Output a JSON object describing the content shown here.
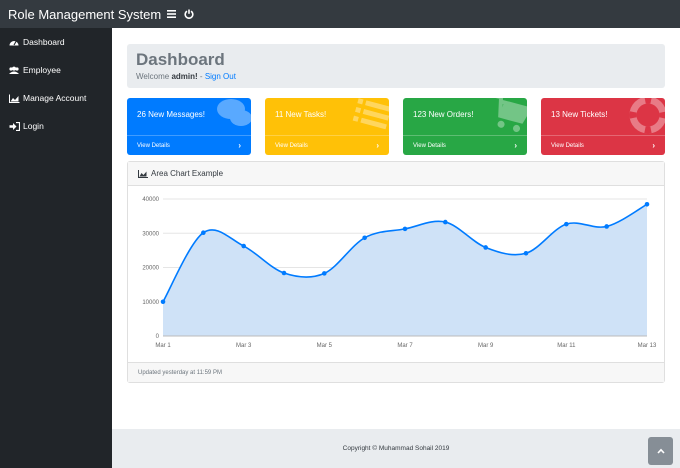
{
  "navbar": {
    "brand": "Role Management System",
    "toggle_icon": "bars-icon",
    "power_icon": "power-icon"
  },
  "sidebar": {
    "items": [
      {
        "label": "Dashboard",
        "icon": "tachometer-icon"
      },
      {
        "label": "Employee",
        "icon": "users-icon"
      },
      {
        "label": "Manage Account",
        "icon": "chart-area-icon"
      },
      {
        "label": "Login",
        "icon": "sign-in-icon"
      }
    ]
  },
  "jumbotron": {
    "title": "Dashboard",
    "welcome_prefix": "Welcome",
    "username": "admin!",
    "separator": "-",
    "signout": "Sign Out"
  },
  "cards": [
    {
      "title": "26 New Messages!",
      "footer": "View Details",
      "color": "#007bff",
      "icon": "comments-icon"
    },
    {
      "title": "11 New Tasks!",
      "footer": "View Details",
      "color": "#ffc107",
      "icon": "list-icon"
    },
    {
      "title": "123 New Orders!",
      "footer": "View Details",
      "color": "#28a745",
      "icon": "shopping-cart-icon"
    },
    {
      "title": "13 New Tickets!",
      "footer": "View Details",
      "color": "#dc3545",
      "icon": "life-ring-icon"
    }
  ],
  "chart_card": {
    "header": "Area Chart Example",
    "footer": "Updated yesterday at 11:59 PM"
  },
  "chart_data": {
    "type": "area",
    "x": [
      "Mar 1",
      "Mar 2",
      "Mar 3",
      "Mar 4",
      "Mar 5",
      "Mar 6",
      "Mar 7",
      "Mar 8",
      "Mar 9",
      "Mar 10",
      "Mar 11",
      "Mar 12",
      "Mar 13"
    ],
    "x_tick_labels": [
      "Mar 1",
      "Mar 3",
      "Mar 5",
      "Mar 7",
      "Mar 9",
      "Mar 11",
      "Mar 13"
    ],
    "values": [
      10000,
      30162,
      26263,
      18394,
      18287,
      28682,
      31274,
      33259,
      25849,
      24159,
      32651,
      31984,
      38451
    ],
    "ylim": [
      0,
      40000
    ],
    "y_ticks": [
      "0",
      "10000",
      "20000",
      "30000",
      "40000"
    ],
    "grid": true,
    "line_color": "#007bff",
    "fill_color": "#cfe2f7"
  },
  "footer": {
    "copyright": "Copyright © Muhammad Sohail 2019"
  },
  "scroll_top": {
    "icon": "chevron-up-icon"
  }
}
